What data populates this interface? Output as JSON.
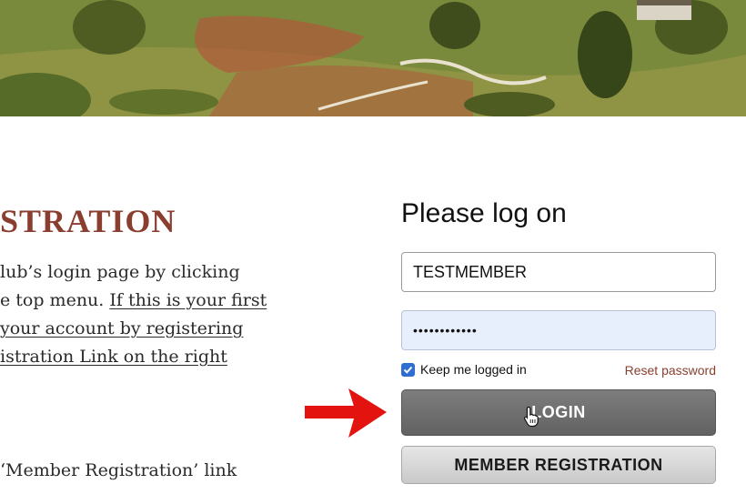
{
  "hero": {
    "alt": "golf course landscape banner"
  },
  "content": {
    "heading": "STRATION",
    "lines": [
      "lub’s login page by clicking",
      "e top menu. ",
      "If this is your first",
      "your account by registering",
      "istration Link on the right"
    ],
    "lower_lines": [
      "‘Member Registration’ link"
    ]
  },
  "login": {
    "title": "Please log on",
    "username_value": "TESTMEMBER",
    "password_mask": "••••••••••••",
    "keep_logged_in_label": "Keep me logged in",
    "keep_logged_in_checked": true,
    "reset_password_label": "Reset password",
    "login_button_label": "LOGIN",
    "register_button_label": "MEMBER REGISTRATION"
  },
  "colors": {
    "heading": "#8a3e2f",
    "arrow": "#e3140f",
    "checkbox": "#2f6ed1",
    "password_bg": "#e8effc"
  }
}
